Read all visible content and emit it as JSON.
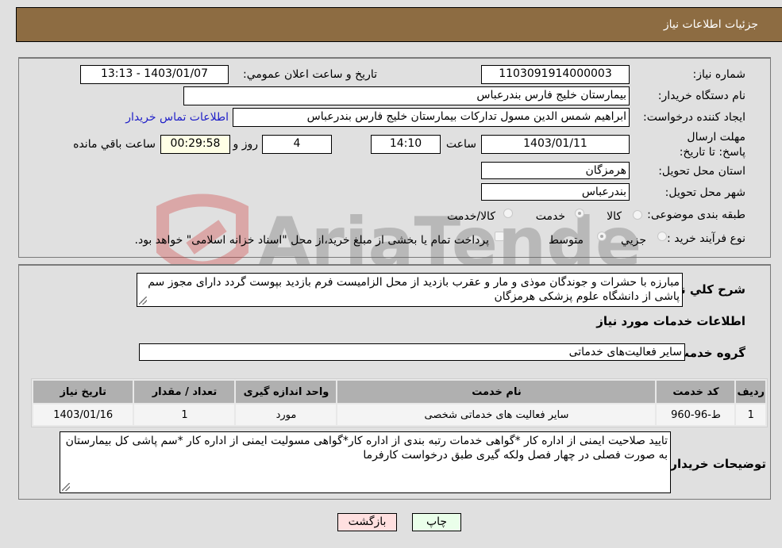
{
  "header": {
    "title": "جزئیات اطلاعات نیاز"
  },
  "need_info": {
    "need_number_label": "شماره نیاز:",
    "need_number": "1103091914000003",
    "announce_label": "تاریخ و ساعت اعلان عمومي:",
    "announce_value": "1403/01/07 - 13:13",
    "buyer_org_label": "نام دستگاه خریدار:",
    "buyer_org": "بیمارستان خلیج فارس بندرعباس",
    "creator_label": "ایجاد کننده درخواست:",
    "creator": "ابراهیم شمس الدین مسول تدارکات بیمارستان خلیج فارس بندرعباس",
    "contact_link": "اطلاعات تماس خریدار",
    "deadline_label": "مهلت ارسال پاسخ: تا تاریخ:",
    "deadline_date": "1403/01/11",
    "time_label": "ساعت",
    "deadline_time": "14:10",
    "days_value": "4",
    "days_label": "روز و",
    "remaining_time": "00:29:58",
    "remaining_label": "ساعت باقي مانده",
    "province_label": "استان محل تحویل:",
    "province": "هرمزگان",
    "city_label": "شهر محل تحویل:",
    "city": "بندرعباس",
    "category_label": "طبقه بندی موضوعی:",
    "category_options": [
      {
        "label": "کالا",
        "checked": false
      },
      {
        "label": "خدمت",
        "checked": true
      },
      {
        "label": "کالا/خدمت",
        "checked": false
      }
    ],
    "process_label": "نوع فرآیند خرید :",
    "process_options": [
      {
        "label": "جزیي",
        "checked": false
      },
      {
        "label": "متوسط",
        "checked": true
      }
    ],
    "treasury_checkbox_label": "پرداخت تمام یا بخشی از مبلغ خرید،از محل \"اسناد خزانه اسلامی\" خواهد بود."
  },
  "description": {
    "label": "شرح کلي نیاز:",
    "text": "مبارزه با حشرات و جوندگان موذی و مار و عقرب بازدید از محل الزامیست فرم بازدید بپوست گردد دارای مجوز سم پاشی از دانشگاه علوم پزشکی هرمزگان"
  },
  "services": {
    "section_title": "اطلاعات خدمات مورد نیاز",
    "group_label": "گروه خدمت:",
    "group_value": "سایر فعالیت‌های خدماتی",
    "columns": [
      "ردیف",
      "کد خدمت",
      "نام خدمت",
      "واحد اندازه گیری",
      "تعداد / مقدار",
      "تاریخ نیاز"
    ],
    "rows": [
      [
        "1",
        "ط-96-960",
        "سایر فعالیت های خدماتی شخصی",
        "مورد",
        "1",
        "1403/01/16"
      ]
    ]
  },
  "buyer_notes": {
    "label": "توضیحات خریدار:",
    "text": "تایید صلاحیت ایمنی از اداره کار *گواهی خدمات رتبه بندی از اداره کار*گواهی مسولیت ایمنی از اداره کار *سم پاشی کل بیمارستان به صورت فصلی در چهار فصل ولکه گیری طبق درخواست کارفرما"
  },
  "buttons": {
    "print": "چاپ",
    "back": "بازگشت"
  },
  "colors": {
    "header_bg": "#8d6c42",
    "print_bg": "#eaffea",
    "back_bg": "#ffe0e0",
    "remaining_bg": "#ffffe6",
    "link": "#1e1ec8"
  },
  "watermark": {
    "text": "AriaTender.neT"
  }
}
